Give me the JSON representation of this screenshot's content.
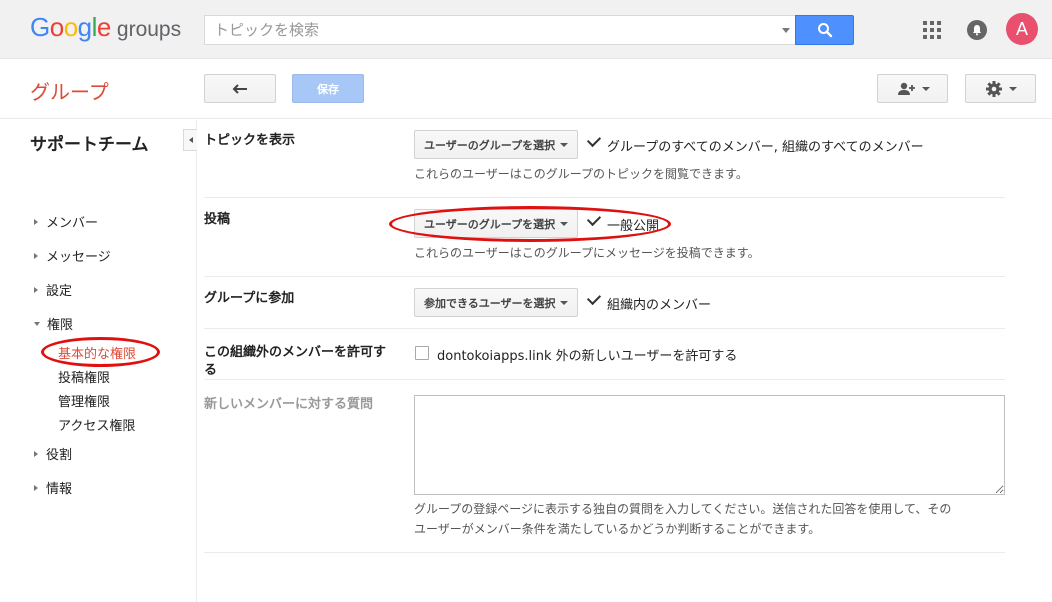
{
  "header": {
    "logo_letters": [
      "G",
      "o",
      "o",
      "g",
      "l",
      "e"
    ],
    "logo_suffix": "groups",
    "search_placeholder": "トピックを検索",
    "avatar_initial": "A"
  },
  "toolbar": {
    "brand": "グループ",
    "save_label": "保存"
  },
  "sidebar": {
    "group_name": "サポートチーム",
    "items": [
      {
        "label": "メンバー"
      },
      {
        "label": "メッセージ"
      },
      {
        "label": "設定"
      },
      {
        "label": "権限"
      },
      {
        "label": "役割"
      },
      {
        "label": "情報"
      }
    ],
    "sub_items": [
      {
        "label": "基本的な権限"
      },
      {
        "label": "投稿権限"
      },
      {
        "label": "管理権限"
      },
      {
        "label": "アクセス権限"
      }
    ]
  },
  "settings": {
    "view_topics": {
      "label": "トピックを表示",
      "dropdown": "ユーザーのグループを選択",
      "selected": "グループのすべてのメンバー, 組織のすべてのメンバー",
      "description": "これらのユーザーはこのグループのトピックを閲覧できます。"
    },
    "post": {
      "label": "投稿",
      "dropdown": "ユーザーのグループを選択",
      "selected": "一般公開",
      "description": "これらのユーザーはこのグループにメッセージを投稿できます。"
    },
    "join": {
      "label": "グループに参加",
      "dropdown": "参加できるユーザーを選択",
      "selected": "組織内のメンバー"
    },
    "external": {
      "label_line1": "この組織外のメンバーを許可す",
      "label_line2": "る",
      "checkbox_label": "dontokoiapps.link 外の新しいユーザーを許可する",
      "checked": false
    },
    "question": {
      "label": "新しいメンバーに対する質問",
      "value": "",
      "description_line1": "グループの登録ページに表示する独自の質問を入力してください。送信された回答を使用して、その",
      "description_line2": "ユーザーがメンバー条件を満たしているかどうか判断することができます。"
    }
  },
  "colors": {
    "accent_red": "#dd4b39",
    "primary_blue": "#4d90fe",
    "annotation_red": "#e01010",
    "avatar_pink": "#e8506e"
  }
}
